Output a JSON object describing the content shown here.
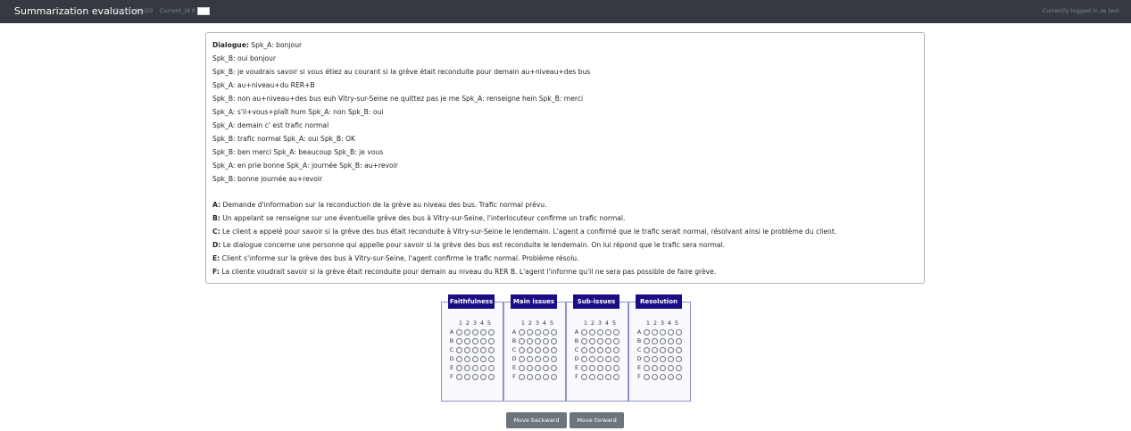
{
  "header": {
    "title": "Summarization evaluation",
    "finished": "Finished 0/20",
    "current_id_label": "Current_id 0",
    "current_id_value": "",
    "login": "Currently logged in as test"
  },
  "dialogue": {
    "label": "Dialogue:",
    "first_line": " Spk_A: bonjour",
    "lines": [
      "Spk_B: oui bonjour",
      "Spk_B: je voudrais savoir si vous étiez au courant si la grève était reconduite pour demain au+niveau+des bus",
      "Spk_A: au+niveau+du RER+B",
      "Spk_B: non au+niveau+des bus euh Vitry-sur-Seine ne quittez pas je me Spk_A: renseigne hein Spk_B: merci",
      "Spk_A: s'il+vous+plaît hum Spk_A: non Spk_B: oui",
      "Spk_A: demain c' est trafic normal",
      "Spk_B: trafic normal Spk_A: oui Spk_B: OK",
      "Spk_B: ben merci Spk_A: beaucoup Spk_B: je vous",
      "Spk_A: en prie bonne Spk_A: journée Spk_B: au+revoir",
      "Spk_B: bonne journée au+revoir"
    ]
  },
  "summaries": [
    {
      "key": "A:",
      "text": " Demande d'information sur la reconduction de la grève au niveau des bus. Trafic normal prévu."
    },
    {
      "key": "B:",
      "text": " Un appelant se renseigne sur une éventuelle grève des bus à Vitry-sur-Seine, l'interlocuteur confirme un trafic normal."
    },
    {
      "key": "C:",
      "text": " Le client a appelé pour savoir si la grève des bus était reconduite à Vitry-sur-Seine le lendemain. L'agent a confirmé que le trafic serait normal, résolvant ainsi le problème du client."
    },
    {
      "key": "D:",
      "text": " Le dialogue concerne une personne qui appelle pour savoir si la grève des bus est reconduite le lendemain. On lui répond que le trafic sera normal."
    },
    {
      "key": "E:",
      "text": " Client s'informe sur la grève des bus à Vitry-sur-Seine, l'agent confirme le trafic normal. Problème résolu."
    },
    {
      "key": "F:",
      "text": " La cliente voudrait savoir si la grève était reconduite pour demain au niveau du RER B. L'agent l'informe qu'il ne sera pas possible de faire grève."
    }
  ],
  "ratings": {
    "criteria": [
      "Faithfulness",
      "Main issues",
      "Sub-issues",
      "Resolution"
    ],
    "scale": [
      "1",
      "2",
      "3",
      "4",
      "5"
    ],
    "rows": [
      "A",
      "B",
      "C",
      "D",
      "E",
      "F"
    ],
    "selected": "none"
  },
  "buttons": {
    "backward": "Move backward",
    "forward": "Move forward"
  },
  "colors": {
    "navbar": "#343a40",
    "criterion_header": "#1a0d83",
    "button": "#6c757d"
  }
}
